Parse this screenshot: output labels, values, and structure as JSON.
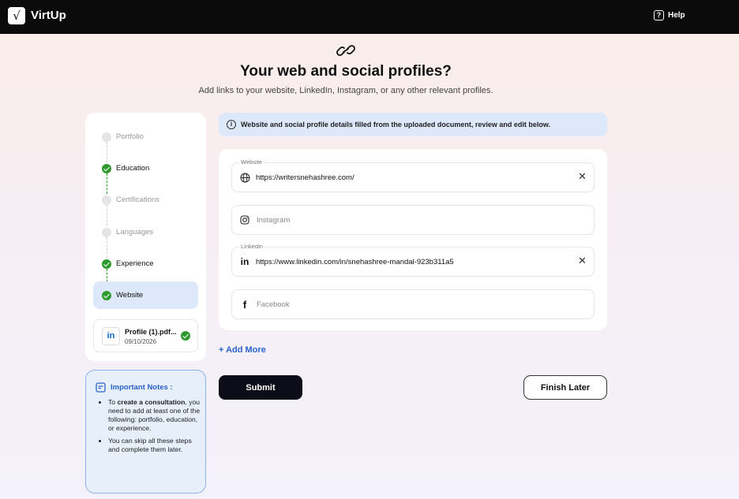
{
  "app": {
    "brand": "VirtUp",
    "help_label": "Help",
    "logo_glyph": "√"
  },
  "header": {
    "title": "Your web and social profiles?",
    "subtitle": "Add links to your website, LinkedIn, Instagram, or any other relevant profiles."
  },
  "steps": [
    {
      "label": "Portfolio",
      "status": "pending"
    },
    {
      "label": "Education",
      "status": "done"
    },
    {
      "label": "Certifications",
      "status": "pending"
    },
    {
      "label": "Languages",
      "status": "pending"
    },
    {
      "label": "Experience",
      "status": "done"
    },
    {
      "label": "Website",
      "status": "active"
    }
  ],
  "file": {
    "icon_text": "in",
    "name": "Profile (1).pdf...",
    "date": "09/10/2026"
  },
  "notes": {
    "title": "Important Notes :",
    "item1_pre": "To ",
    "item1_bold": "create a consultation",
    "item1_post": ", you need to add at least one of the following: portfolio, education, or experience.",
    "item2": "You can skip all these steps and complete them later."
  },
  "info": {
    "text": "Website and social profile details filled from the uploaded document, review and edit below."
  },
  "fields": {
    "website": {
      "label": "Website",
      "value": "https://writersnehashree.com/",
      "icon": "globe-icon"
    },
    "instagram": {
      "placeholder": "Instagram",
      "icon": "instagram-icon"
    },
    "linkedin": {
      "label": "Linkedin",
      "value": "https://www.linkedin.com/in/snehashree-mandal-923b311a5",
      "icon": "linkedin-icon"
    },
    "facebook": {
      "placeholder": "Facebook",
      "icon": "facebook-icon"
    }
  },
  "actions": {
    "add_more": "+ Add More",
    "submit": "Submit",
    "finish_later": "Finish Later"
  },
  "colors": {
    "accent": "#2a62c9",
    "success": "#2e9a2e",
    "dark": "#0d0d1a"
  }
}
